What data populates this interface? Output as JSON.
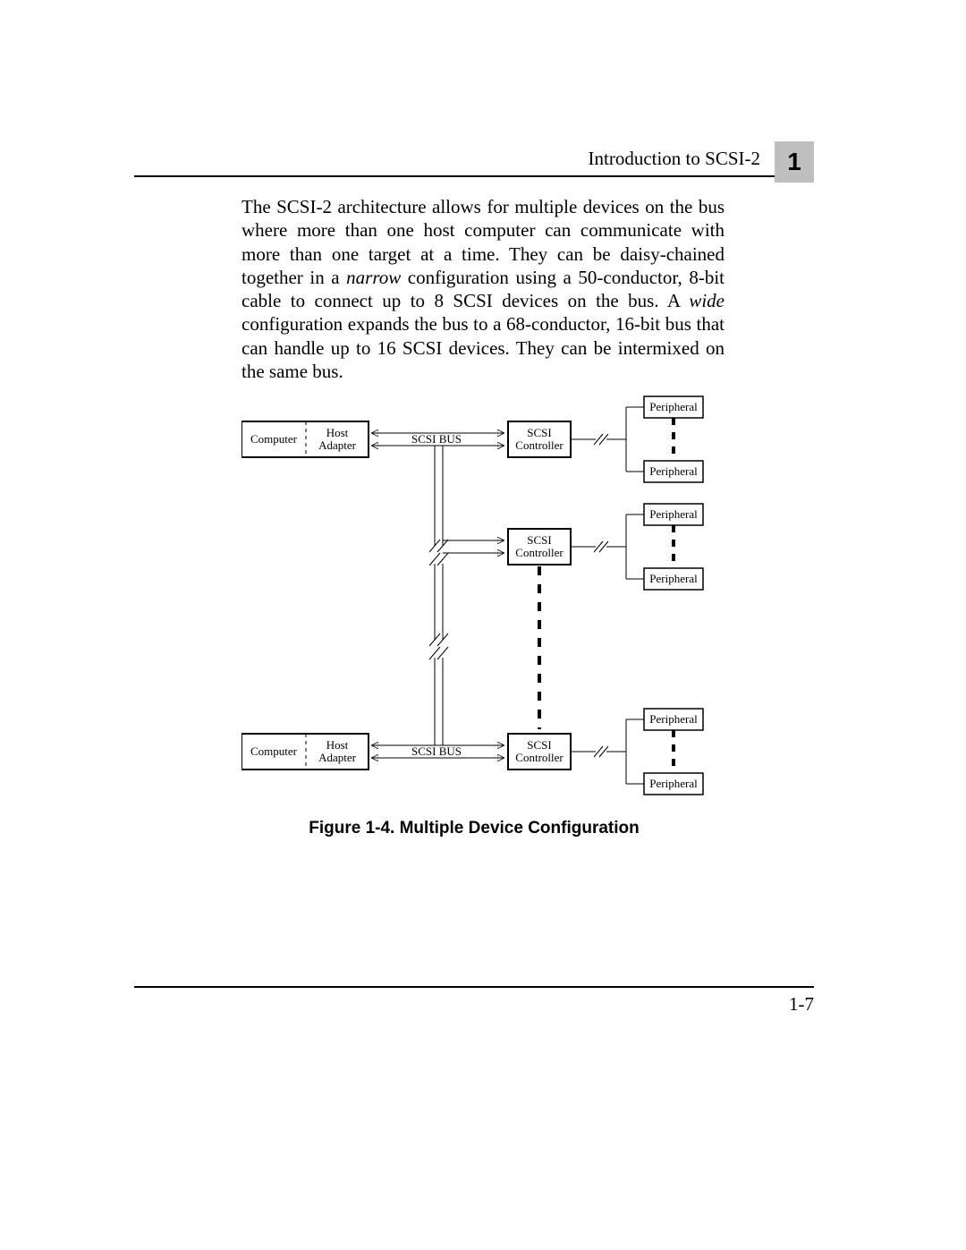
{
  "header": {
    "running_title": "Introduction to SCSI-2",
    "chapter_number": "1"
  },
  "paragraph": {
    "s1": "The SCSI-2 architecture allows for multiple devices on the bus where more than one host computer can communicate with more than one target at a time. They can be daisy-chained together in a ",
    "s2_italic": "narrow",
    "s3": " configuration using a 50-conductor, 8-bit cable to connect up to 8 SCSI devices on the bus. A ",
    "s4_italic": "wide",
    "s5": " configuration expands the bus to a 68-conductor, 16-bit bus that can handle up to 16 SCSI devices. They can be intermixed on the same bus."
  },
  "diagram": {
    "computer": "Computer",
    "host_adapter_l1": "Host",
    "host_adapter_l2": "Adapter",
    "scsi_bus": "SCSI BUS",
    "scsi_controller_l1": "SCSI",
    "scsi_controller_l2": "Controller",
    "peripheral": "Peripheral"
  },
  "figure_caption": "Figure 1-4.  Multiple Device Configuration",
  "footer": {
    "page_number": "1-7"
  }
}
